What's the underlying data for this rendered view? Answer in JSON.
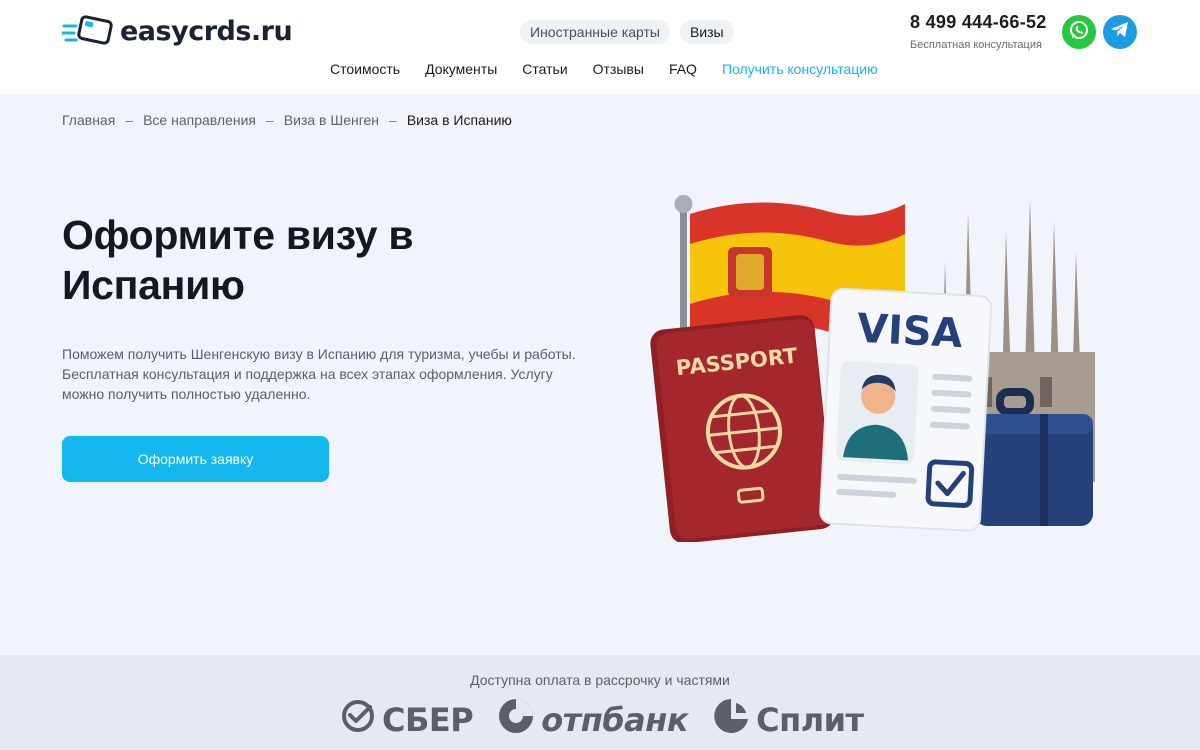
{
  "logo": {
    "text": "easycrds.ru"
  },
  "top_pills": [
    {
      "label": "Иностранные карты",
      "active": false
    },
    {
      "label": "Визы",
      "active": true
    }
  ],
  "contact": {
    "phone": "8 499 444-66-52",
    "subtitle": "Бесплатная консультация",
    "whatsapp_icon": "whatsapp-icon",
    "telegram_icon": "telegram-icon"
  },
  "main_nav": [
    {
      "label": "Стоимость"
    },
    {
      "label": "Документы"
    },
    {
      "label": "Статьи"
    },
    {
      "label": "Отзывы"
    },
    {
      "label": "FAQ"
    },
    {
      "label": "Получить консультацию"
    }
  ],
  "breadcrumb": {
    "separator": "–",
    "items": [
      "Главная",
      "Все направления",
      "Виза в Шенген",
      "Виза в Испанию"
    ]
  },
  "hero": {
    "title": "Оформите визу в Испанию",
    "description": "Поможем получить Шенгенскую визу в Испанию для туризма, учебы и работы. Бесплатная консультация и поддержка на всех этапах оформления. Услугу можно получить полностью удаленно.",
    "cta_label": "Оформить заявку",
    "illustration": {
      "passport_text": "PASSPORT",
      "visa_text": "VISA"
    }
  },
  "payments": {
    "title": "Доступна оплата в рассрочку и частями",
    "providers": [
      {
        "name": "СБЕР",
        "icon": "sber-logo-icon"
      },
      {
        "name": "отпбанк",
        "icon": "otp-logo-icon"
      },
      {
        "name": "Сплит",
        "icon": "split-logo-icon"
      }
    ]
  },
  "colors": {
    "accent": "#15b8ee",
    "hero_bg": "#f1f4fb",
    "pay_bg": "#e5e9f0",
    "whatsapp": "#25c83e",
    "telegram": "#1e9be0"
  }
}
